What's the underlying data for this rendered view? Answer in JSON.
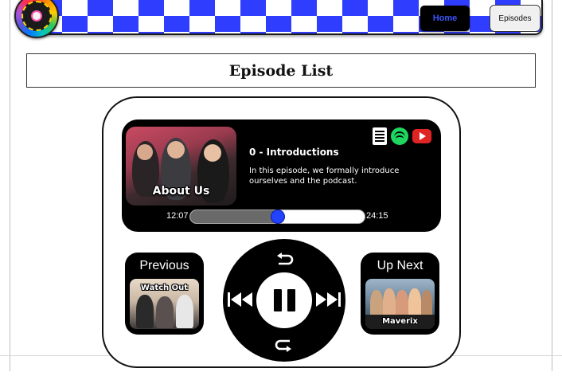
{
  "nav": {
    "home_label": "Home",
    "episodes_label": "Episodes"
  },
  "page": {
    "title": "Episode List"
  },
  "player": {
    "current_episode": {
      "title": "0 - Introductions",
      "description": "In this episode, we formally introduce ourselves and the podcast.",
      "thumbnail_label": "About Us"
    },
    "platforms": [
      "transcript-icon",
      "spotify-icon",
      "youtube-icon"
    ],
    "time_current": "12:07",
    "time_total": "24:15",
    "progress_fraction": 0.5,
    "previous": {
      "label": "Previous",
      "thumbnail_label": "Watch Out"
    },
    "next": {
      "label": "Up Next",
      "thumbnail_label": "Maverix"
    },
    "controls": [
      "replay-icon",
      "skip-back-icon",
      "pause-icon",
      "skip-forward-icon",
      "forward-icon"
    ]
  },
  "colors": {
    "banner_blue": "#2f3dff",
    "home_text": "#3a55ff",
    "progress_knob": "#2143ff",
    "progress_fill": "#6a6a6a"
  }
}
